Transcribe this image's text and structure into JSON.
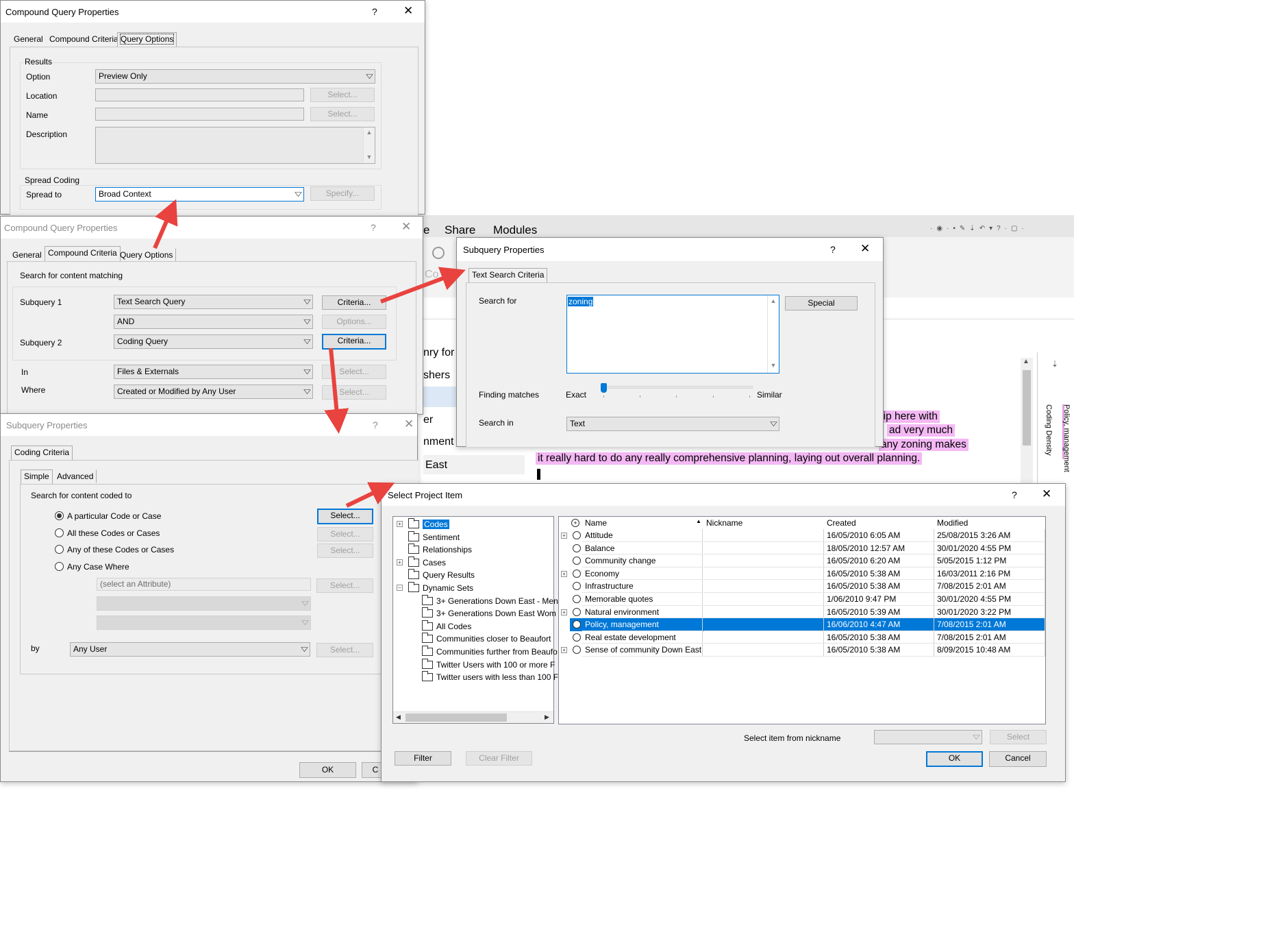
{
  "win1": {
    "title": "Compound Query Properties",
    "help": "?",
    "close": "✕",
    "tabs": [
      "General",
      "Compound Criteria",
      "Query Options"
    ],
    "results_group": "Results",
    "option_label": "Option",
    "option_value": "Preview Only",
    "location_label": "Location",
    "name_label": "Name",
    "description_label": "Description",
    "select_label": "Select...",
    "spread_group": "Spread Coding",
    "spread_label": "Spread to",
    "spread_value": "Broad Context",
    "specify_label": "Specify..."
  },
  "win2": {
    "title": "Compound Query Properties",
    "help": "?",
    "close": "✕",
    "tabs": [
      "General",
      "Compound Criteria",
      "Query Options"
    ],
    "search_heading": "Search for content matching",
    "subquery1_label": "Subquery 1",
    "subquery1_value": "Text Search Query",
    "criteria_label": "Criteria...",
    "operator_value": "AND",
    "options_label": "Options...",
    "subquery2_label": "Subquery 2",
    "subquery2_value": "Coding Query",
    "in_label": "In",
    "in_value": "Files & Externals",
    "where_label": "Where",
    "where_value": "Created or Modified by Any User",
    "select_label": "Select..."
  },
  "background_app": {
    "menu": [
      "e",
      "Share",
      "Modules"
    ],
    "side_fragments": [
      "nry for",
      "shers",
      "er",
      "nment",
      "East"
    ],
    "codes_fragment": "Co",
    "side_text": [
      "Coding Density",
      "Policy, management"
    ],
    "doc_lines": [
      "hip here with",
      "ad very much",
      "any zoning makes",
      "it really hard to do any really comprehensive planning, laying out overall planning."
    ]
  },
  "win3": {
    "title": "Subquery Properties",
    "help": "?",
    "close": "✕",
    "tab": "Text Search Criteria",
    "search_for_label": "Search for",
    "search_for_value": "zoning",
    "special_label": "Special",
    "finding_label": "Finding matches",
    "exact_label": "Exact",
    "similar_label": "Similar",
    "finding_level": 0,
    "search_in_label": "Search in",
    "search_in_value": "Text"
  },
  "win4": {
    "title": "Subquery Properties",
    "help": "?",
    "close": "✕",
    "tab": "Coding Criteria",
    "subtabs": [
      "Simple",
      "Advanced"
    ],
    "heading": "Search for content coded to",
    "options": [
      "A particular Code or Case",
      "All these Codes or Cases",
      "Any of these Codes or Cases",
      "Any Case Where"
    ],
    "selected_option": 0,
    "attribute_placeholder": "(select an Attribute)",
    "by_label": "by",
    "by_value": "Any User",
    "select_label": "Select...",
    "ok_label": "OK",
    "cancel_fragment": "C"
  },
  "win5": {
    "title": "Select Project Item",
    "help": "?",
    "close": "✕",
    "tree": [
      {
        "label": "Codes",
        "level": 0,
        "expander": "+",
        "selected": true
      },
      {
        "label": "Sentiment",
        "level": 0,
        "expander": ""
      },
      {
        "label": "Relationships",
        "level": 0,
        "expander": ""
      },
      {
        "label": "Cases",
        "level": 0,
        "expander": "+"
      },
      {
        "label": "Query Results",
        "level": 0,
        "expander": ""
      },
      {
        "label": "Dynamic Sets",
        "level": 0,
        "expander": "−"
      },
      {
        "label": "3+ Generations Down East - Men",
        "level": 1,
        "expander": ""
      },
      {
        "label": "3+ Generations Down East Wom",
        "level": 1,
        "expander": ""
      },
      {
        "label": "All Codes",
        "level": 1,
        "expander": ""
      },
      {
        "label": "Communities closer to Beaufort",
        "level": 1,
        "expander": ""
      },
      {
        "label": "Communities further from Beaufo",
        "level": 1,
        "expander": ""
      },
      {
        "label": "Twitter Users with 100 or more F",
        "level": 1,
        "expander": ""
      },
      {
        "label": "Twitter users with less than 100 F",
        "level": 1,
        "expander": ""
      }
    ],
    "columns": [
      "Name",
      "Nickname",
      "Created",
      "Modified"
    ],
    "rows": [
      {
        "name": "Attitude",
        "nickname": "",
        "created": "16/05/2010 6:05 AM",
        "modified": "25/08/2015 3:26 AM",
        "expander": "+",
        "selected": false
      },
      {
        "name": "Balance",
        "nickname": "",
        "created": "18/05/2010 12:57 AM",
        "modified": "30/01/2020 4:55 PM",
        "expander": "",
        "selected": false
      },
      {
        "name": "Community change",
        "nickname": "",
        "created": "16/05/2010 6:20 AM",
        "modified": "5/05/2015 1:12 PM",
        "expander": "",
        "selected": false
      },
      {
        "name": "Economy",
        "nickname": "",
        "created": "16/05/2010 5:38 AM",
        "modified": "16/03/2011 2:16 PM",
        "expander": "+",
        "selected": false
      },
      {
        "name": "Infrastructure",
        "nickname": "",
        "created": "16/05/2010 5:38 AM",
        "modified": "7/08/2015 2:01 AM",
        "expander": "",
        "selected": false
      },
      {
        "name": "Memorable quotes",
        "nickname": "",
        "created": "1/06/2010 9:47 PM",
        "modified": "30/01/2020 4:55 PM",
        "expander": "",
        "selected": false
      },
      {
        "name": "Natural environment",
        "nickname": "",
        "created": "16/05/2010 5:39 AM",
        "modified": "30/01/2020 3:22 PM",
        "expander": "+",
        "selected": false
      },
      {
        "name": "Policy, management",
        "nickname": "",
        "created": "16/06/2010 4:47 AM",
        "modified": "7/08/2015 2:01 AM",
        "expander": "",
        "selected": true
      },
      {
        "name": "Real estate development",
        "nickname": "",
        "created": "16/05/2010 5:38 AM",
        "modified": "7/08/2015 2:01 AM",
        "expander": "",
        "selected": false
      },
      {
        "name": "Sense of community Down East",
        "nickname": "",
        "created": "16/05/2010 5:38 AM",
        "modified": "8/09/2015 10:48 AM",
        "expander": "+",
        "selected": false
      }
    ],
    "nickname_label": "Select item from nickname",
    "select_label": "Select",
    "filter_label": "Filter",
    "clear_filter_label": "Clear Filter",
    "ok_label": "OK",
    "cancel_label": "Cancel"
  },
  "colors": {
    "accent": "#0078d7",
    "arrow": "#e8433f",
    "highlight": "#f4b8f4",
    "selection": "#0078d7"
  }
}
